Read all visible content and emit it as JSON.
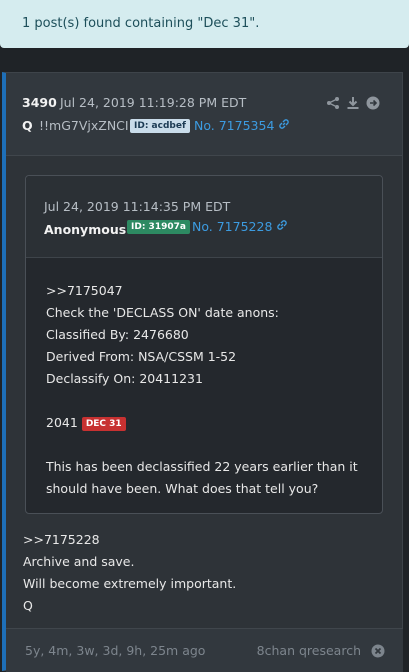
{
  "alert": {
    "text": "1 post(s) found containing \"Dec 31\"."
  },
  "post": {
    "number": "3490",
    "date": "Jul 24, 2019 11:19:28 PM EDT",
    "name": "Q",
    "tripcode": "!!mG7VjxZNCI",
    "id_label": "ID: acdbef",
    "post_link": "No. 7175354",
    "icons": [
      "share-icon",
      "download-icon",
      "arrow-right-circle-icon"
    ],
    "quoted": {
      "date": "Jul 24, 2019 11:14:35 PM EDT",
      "name": "Anonymous",
      "id_label": "ID: 31907a",
      "post_link": "No. 7175228",
      "lines": [
        ">>7175047",
        "Check the 'DECLASS ON' date anons:",
        "Classified By: 2476680",
        "Derived From: NSA/CSSM 1-52",
        "Declassify On: 20411231"
      ],
      "year": "2041",
      "tag": "DEC 31",
      "closing": "This has been declassified 22 years earlier than it should have been. What does that tell you?"
    },
    "body": [
      ">>7175228",
      "Archive and save.",
      "Will become extremely important.",
      "Q"
    ],
    "footer": {
      "ago": "5y, 4m, 3w, 3d, 9h, 25m ago",
      "board": "8chan qresearch"
    }
  },
  "colors": {
    "accent": "#3c9be0",
    "alert_bg": "#d5ecef",
    "tag_red": "#c73131",
    "id_green": "#2d8a62"
  }
}
